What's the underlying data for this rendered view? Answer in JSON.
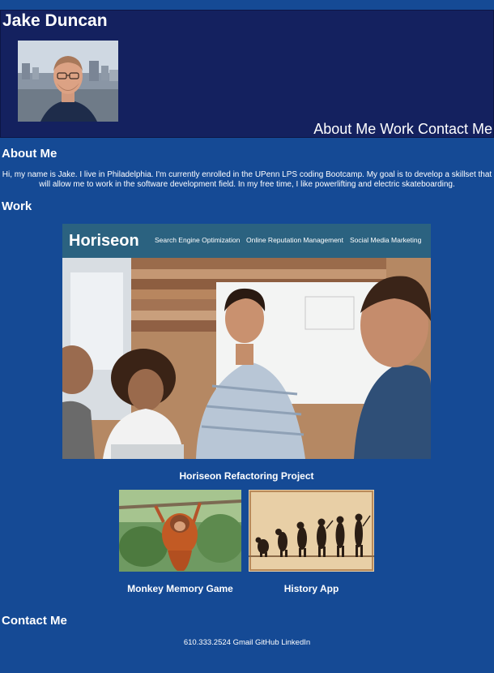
{
  "header": {
    "name": "Jake Duncan",
    "nav": [
      "About Me",
      "Work",
      "Contact Me"
    ]
  },
  "about": {
    "title": "About Me",
    "text": "Hi, my name is Jake. I live in Philadelphia. I'm currently enrolled in the UPenn LPS coding Bootcamp. My goal is to develop a skillset that will allow me to work in the software development field. In my free time, I like powerlifting and electric skateboarding."
  },
  "work": {
    "title": "Work",
    "featured": {
      "caption": "Horiseon Refactoring Project",
      "brand": "Horiseon",
      "menu": [
        "Search Engine Optimization",
        "Online Reputation Management",
        "Social Media Marketing"
      ]
    },
    "projects": [
      {
        "caption": "Monkey Memory Game"
      },
      {
        "caption": "History App"
      }
    ]
  },
  "contact": {
    "title": "Contact Me",
    "phone": "610.333.2524",
    "links": [
      "Gmail",
      "GitHub",
      "LinkedIn"
    ]
  },
  "colors": {
    "page_background": "#154a95",
    "header_background": "#14215f",
    "text": "#ffffff"
  },
  "icons": [
    "profile-photo",
    "horiseon-screenshot",
    "orangutan-photo",
    "evolution-illustration"
  ]
}
